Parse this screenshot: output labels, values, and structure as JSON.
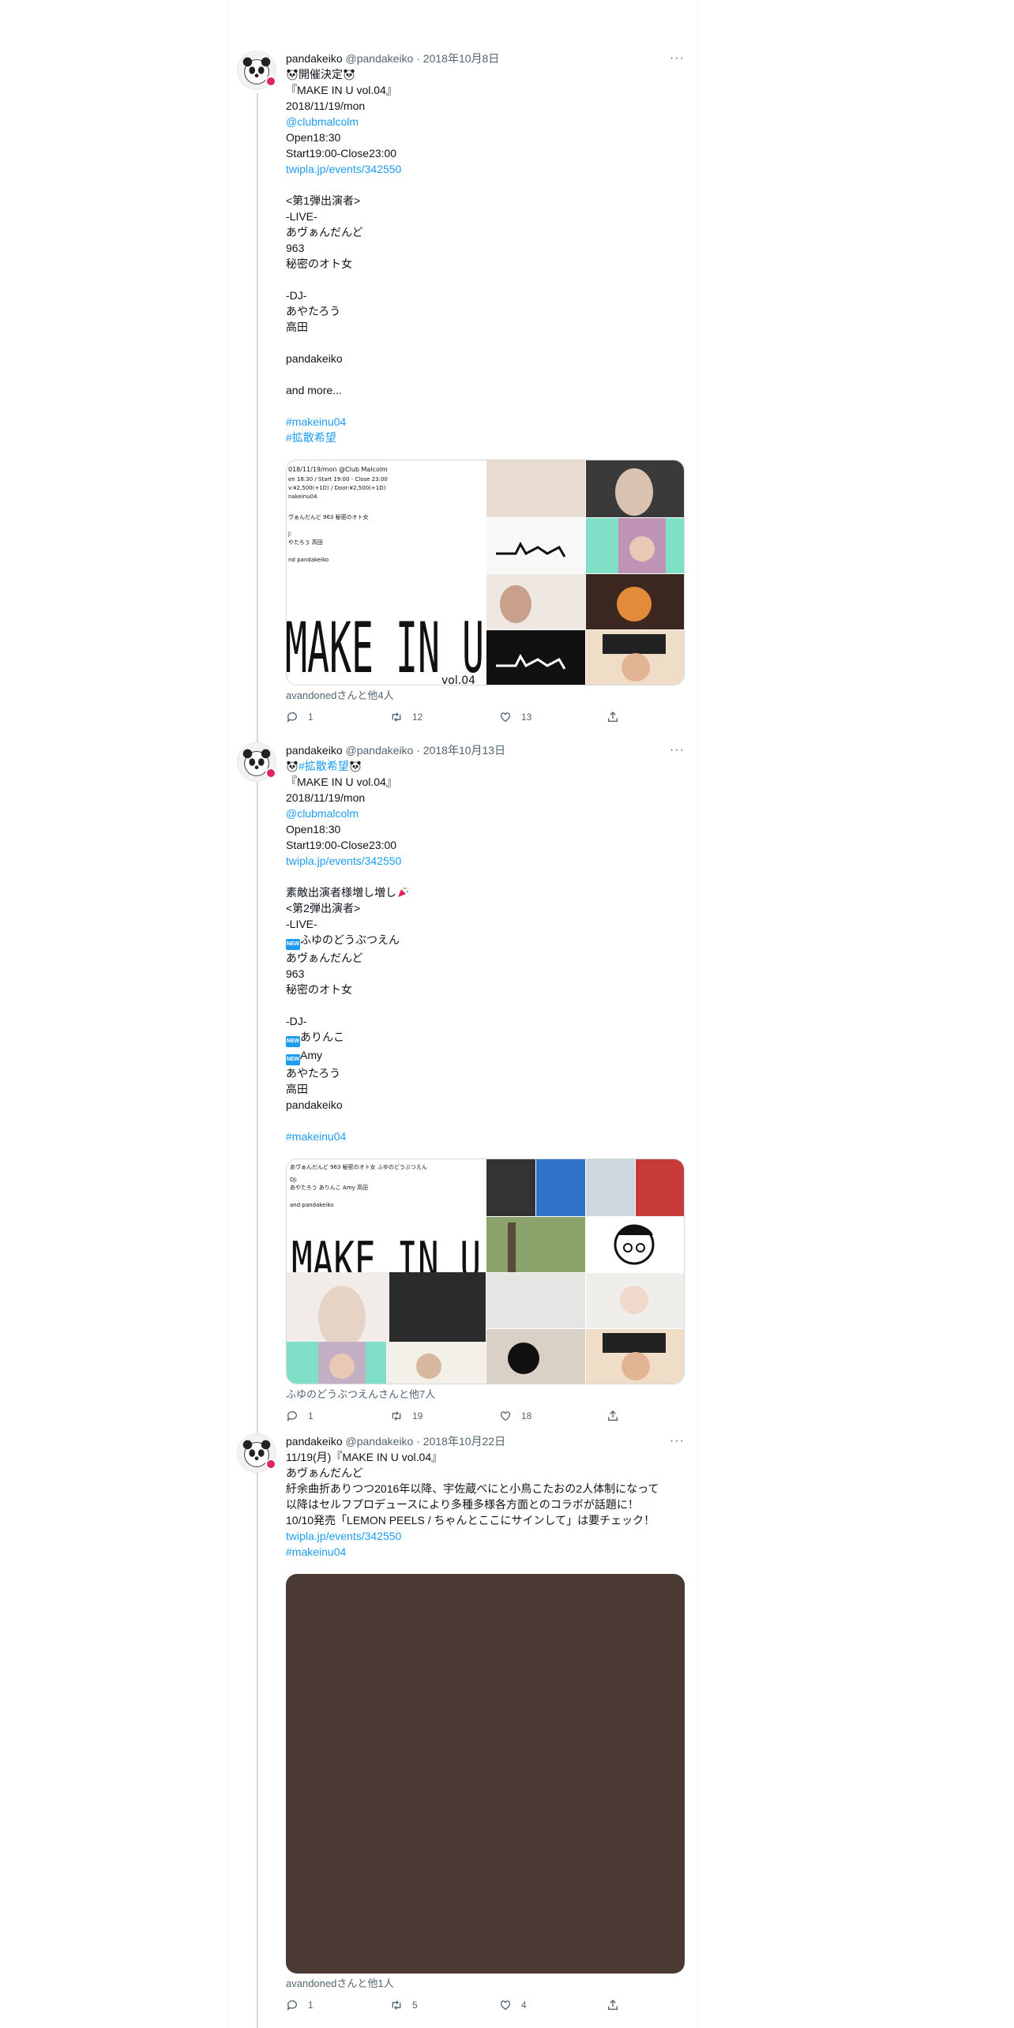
{
  "tweets": [
    {
      "name": "pandakeiko",
      "handle": "@pandakeiko",
      "date": "2018年10月8日",
      "more": "···",
      "lines": [
        {
          "t": "開催決定",
          "emoji_both": true
        },
        {
          "t": "『MAKE IN U vol.04』"
        },
        {
          "t": "2018/11/19/mon"
        },
        {
          "t": "@clubmalcolm",
          "link": true
        },
        {
          "t": "Open18:30"
        },
        {
          "t": "Start19:00-Close23:00"
        },
        {
          "t": "twipla.jp/events/342550",
          "link": true
        },
        {
          "t": ""
        },
        {
          "t": "<第1弾出演者>"
        },
        {
          "t": "-LIVE-"
        },
        {
          "t": "あヴぁんだんど"
        },
        {
          "t": "963"
        },
        {
          "t": "秘密のオト女"
        },
        {
          "t": ""
        },
        {
          "t": "-DJ-"
        },
        {
          "t": "あやたろう"
        },
        {
          "t": "高田"
        },
        {
          "t": ""
        },
        {
          "t": "pandakeiko"
        },
        {
          "t": ""
        },
        {
          "t": "and more..."
        },
        {
          "t": ""
        },
        {
          "t": "#makeinu04",
          "link": true
        },
        {
          "t": "#拡散希望",
          "link": true
        }
      ],
      "media_text": {
        "info1": "018/11/19/mon  @Club Malcolm",
        "info2": "en 18:30  /  Start 19:00 - Close 23:00",
        "info3": "v:¥2,500(+1D)  /  Door:¥2,500(+1D)",
        "info4": "nakeinu04",
        "info5": "ヴぁんだんど  963  秘密のオト女",
        "info6": "J:",
        "info7": "やたろう  高田",
        "info8": "nd pandakeiko",
        "logo": "MAKE IN U",
        "vol": "vol.04"
      },
      "likes": "avandonedさんと他4人",
      "reply": "1",
      "retweet": "12",
      "like": "13"
    },
    {
      "name": "pandakeiko",
      "handle": "@pandakeiko",
      "date": "2018年10月13日",
      "more": "···",
      "lines": [
        {
          "t": "#拡散希望",
          "link": true,
          "emoji_both": true
        },
        {
          "t": "『MAKE IN U vol.04』"
        },
        {
          "t": "2018/11/19/mon"
        },
        {
          "t": "@clubmalcolm",
          "link": true
        },
        {
          "t": "Open18:30"
        },
        {
          "t": "Start19:00-Close23:00"
        },
        {
          "t": "twipla.jp/events/342550",
          "link": true
        },
        {
          "t": ""
        },
        {
          "t": "素敵出演者様増し増し",
          "party": true
        },
        {
          "t": "<第2弾出演者>"
        },
        {
          "t": "-LIVE-"
        },
        {
          "t": "ふゆのどうぶつえん",
          "newtag": true
        },
        {
          "t": "あヴぁんだんど"
        },
        {
          "t": "963"
        },
        {
          "t": "秘密のオト女"
        },
        {
          "t": ""
        },
        {
          "t": "-DJ-"
        },
        {
          "t": "ありんこ",
          "newtag": true
        },
        {
          "t": "Amy",
          "newtag": true
        },
        {
          "t": "あやたろう"
        },
        {
          "t": "高田"
        },
        {
          "t": "pandakeiko"
        },
        {
          "t": ""
        },
        {
          "t": "#makeinu04",
          "link": true
        }
      ],
      "media_text": {
        "info1": "あヴぁんだんど  963  秘密のオト女  ふゆのどうぶつえん",
        "info2": "DJ:",
        "info3": "あやたろう  ありんこ  Amy  高田",
        "info4": "and pandakeiko",
        "logo": "MAKE IN U"
      },
      "likes": "ふゆのどうぶつえんさんと他7人",
      "reply": "1",
      "retweet": "19",
      "like": "18"
    },
    {
      "name": "pandakeiko",
      "handle": "@pandakeiko",
      "date": "2018年10月22日",
      "more": "···",
      "lines": [
        {
          "t": "11/19(月)『MAKE IN U vol.04』"
        },
        {
          "t": "あヴぁんだんど"
        },
        {
          "t": "紆余曲折ありつつ2016年以降、宇佐蔵べにと小鳥こたおの2人体制になって"
        },
        {
          "t": "以降はセルフプロデュースにより多種多様各方面とのコラボが話題に！"
        },
        {
          "t": "10/10発売「LEMON PEELS / ちゃんとここにサインして」は要チェック！"
        },
        {
          "t": "twipla.jp/events/342550",
          "link": true
        },
        {
          "t": "#makeinu04",
          "link": true
        }
      ],
      "likes": "avandonedさんと他1人",
      "reply": "1",
      "retweet": "5",
      "like": "4"
    }
  ],
  "colors": {
    "link": "#1d9bf0",
    "meta": "#536471",
    "text": "#0f1419",
    "media3": "#4a3a33"
  },
  "icons": [
    "panda-avatar-icon",
    "more-icon",
    "reply-icon",
    "retweet-icon",
    "like-icon",
    "share-icon",
    "panda-emoji-icon",
    "party-emoji-icon",
    "new-tag-icon"
  ]
}
